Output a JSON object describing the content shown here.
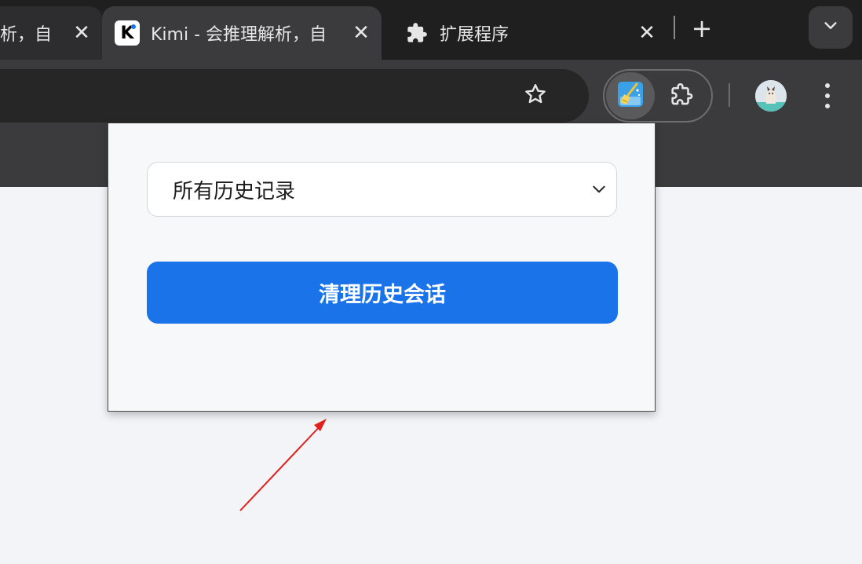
{
  "browser": {
    "tabs": [
      {
        "title": "析，自",
        "active": false,
        "favicon": "none"
      },
      {
        "title": "Kimi - 会推理解析，自",
        "active": true,
        "favicon": "kimi-logo"
      },
      {
        "title": "扩展程序",
        "active": false,
        "favicon": "puzzle-icon"
      }
    ],
    "close_glyph": "✕",
    "new_tab_glyph": "+",
    "toolbar": {
      "bookmark_icon": "star-icon",
      "extension_active_icon": "broom-clean-icon",
      "extensions_icon": "puzzle-icon",
      "menu_icon": "vertical-dots-icon"
    }
  },
  "popup": {
    "select": {
      "value": "所有历史记录",
      "icon": "chevron-down-icon"
    },
    "clean_button": {
      "label": "清理历史会话",
      "color": "#1a73e8"
    }
  },
  "annotation": {
    "type": "red-arrow",
    "color": "#e0201b"
  },
  "colors": {
    "tabstrip": "#1f1f1f",
    "toolbar": "#3b3b3d",
    "page_bg": "#f3f4f8",
    "popup_bg": "#f7f8fa"
  }
}
